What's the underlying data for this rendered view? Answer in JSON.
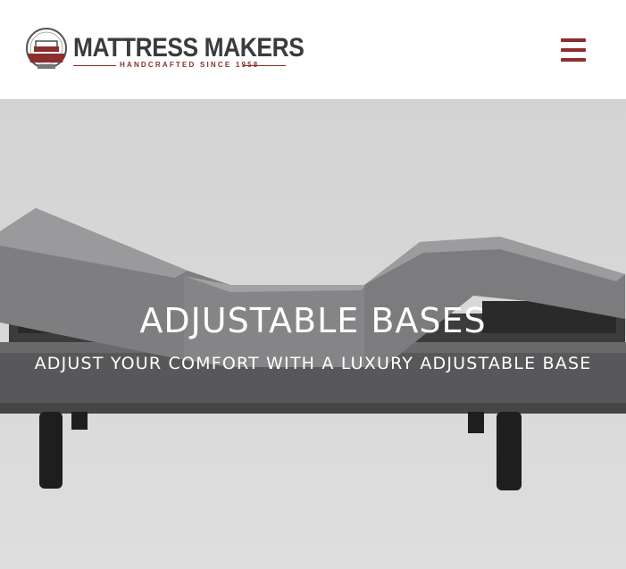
{
  "header": {
    "brand_name": "MATTRESS MAKERS",
    "brand_tagline": "HANDCRAFTED SINCE 1958",
    "menu_icon": "hamburger-menu-icon"
  },
  "hero": {
    "title": "ADJUSTABLE BASES",
    "subtitle": "ADJUST YOUR COMFORT WITH A LUXURY ADJUSTABLE BASE"
  },
  "colors": {
    "brand": "#8b2e2e",
    "logo_text": "#3b3b3b",
    "hero_background": "#d6d6d6",
    "hero_text": "#ffffff"
  }
}
